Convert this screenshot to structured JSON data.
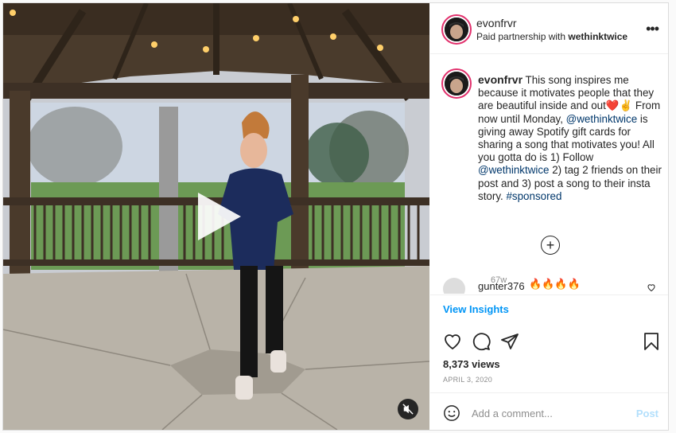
{
  "header": {
    "username": "evonfrvr",
    "partnership_prefix": "Paid partnership with ",
    "partner": "wethinktwice",
    "more": "•••"
  },
  "caption": {
    "username": "evonfrvr",
    "part1": " This song inspires me because it motivates people that they are beautiful inside and out",
    "emoji": "❤️✌️",
    "part2": " From now until Monday, ",
    "mention1": "@wethinktwice",
    "part3": " is giving away Spotify gift cards for sharing a song that motivates you! All you gotta do is 1) Follow ",
    "mention2": "@wethinktwice",
    "part4": " 2) tag 2 friends on their post and 3) post a song to their insta story. ",
    "hashtag": "#sponsored",
    "age": "67w"
  },
  "load_more": "+",
  "comment": {
    "username": "gunter376",
    "text": "🔥🔥🔥🔥"
  },
  "view_insights": "View Insights",
  "views": "8,373 views",
  "date": "APRIL 3, 2020",
  "add_comment": {
    "placeholder": "Add a comment...",
    "post": "Post"
  },
  "colors": {
    "link": "#00376b",
    "accent": "#0095f6",
    "post_disabled": "#b2dffc",
    "story_ring": "#e1306c"
  }
}
